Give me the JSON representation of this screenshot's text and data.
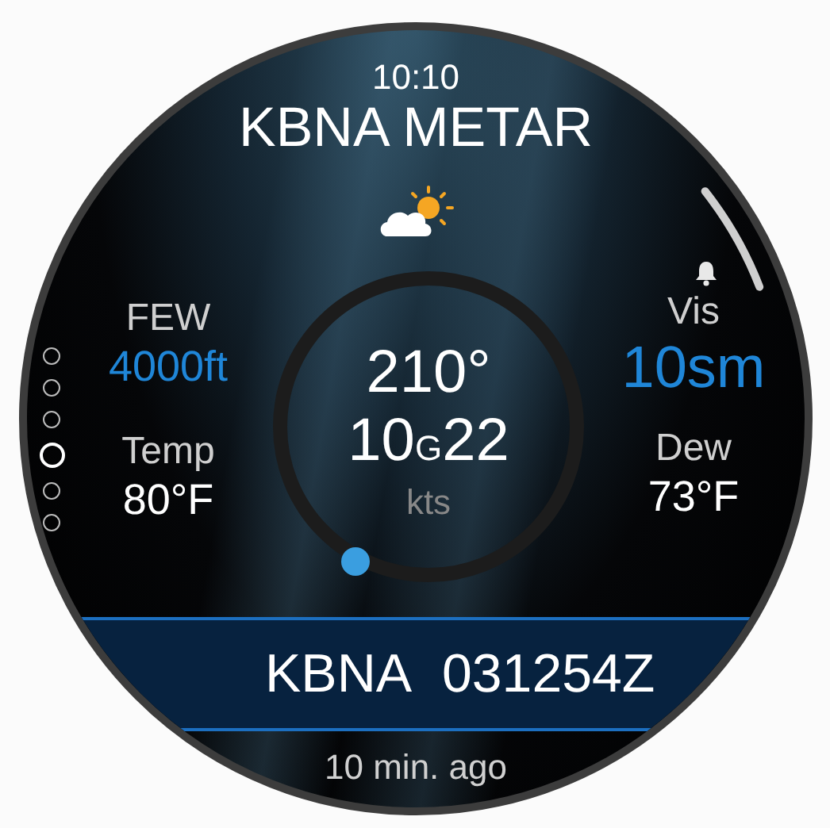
{
  "time": "10:10",
  "title": "KBNA METAR",
  "pages": [
    {
      "selected": false
    },
    {
      "selected": false
    },
    {
      "selected": false
    },
    {
      "selected": true
    },
    {
      "selected": false
    },
    {
      "selected": false
    }
  ],
  "clouds": {
    "label": "FEW",
    "value": "4000ft"
  },
  "temperature": {
    "label": "Temp",
    "value": "80°F"
  },
  "wind": {
    "direction": "210°",
    "speed": "10",
    "gust_marker": "G",
    "gust": "22",
    "unit": "kts"
  },
  "visibility": {
    "label": "Vis",
    "value": "10sm"
  },
  "dewpoint": {
    "label": "Dew",
    "value": "73°F"
  },
  "report": {
    "station": "KBNA",
    "timestamp": "031254Z"
  },
  "age": "10 min. ago"
}
